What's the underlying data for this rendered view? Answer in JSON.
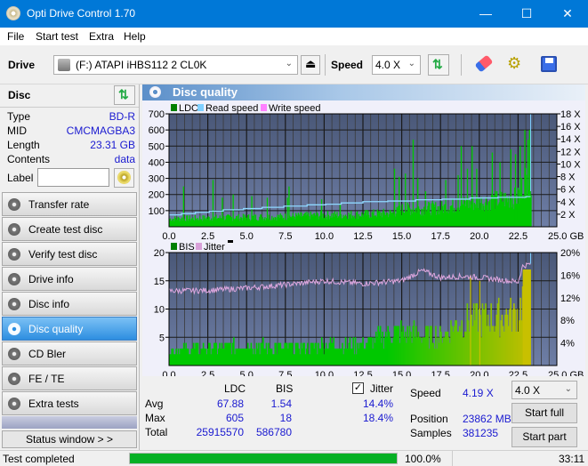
{
  "window": {
    "title": "Opti Drive Control 1.70",
    "minimize": "—",
    "maximize": "☐",
    "close": "✕"
  },
  "menu": [
    "File",
    "Start test",
    "Extra",
    "Help"
  ],
  "toolbar": {
    "drive_label": "Drive",
    "drive_value": "(F:)  ATAPI iHBS112  2 CL0K",
    "speed_label": "Speed",
    "speed_value": "4.0 X"
  },
  "disc": {
    "header": "Disc",
    "rows": [
      {
        "label": "Type",
        "value": "BD-R"
      },
      {
        "label": "MID",
        "value": "CMCMAGBA3"
      },
      {
        "label": "Length",
        "value": "23.31 GB"
      },
      {
        "label": "Contents",
        "value": "data"
      }
    ],
    "label_field_label": "Label",
    "label_field_value": ""
  },
  "nav": [
    {
      "label": "Transfer rate",
      "active": false
    },
    {
      "label": "Create test disc",
      "active": false
    },
    {
      "label": "Verify test disc",
      "active": false
    },
    {
      "label": "Drive info",
      "active": false
    },
    {
      "label": "Disc info",
      "active": false
    },
    {
      "label": "Disc quality",
      "active": true
    },
    {
      "label": "CD Bler",
      "active": false
    },
    {
      "label": "FE / TE",
      "active": false
    },
    {
      "label": "Extra tests",
      "active": false
    }
  ],
  "status_window_button": "Status window > >",
  "panel_title": "Disc quality",
  "colors": {
    "ldc": "#00c000",
    "read_speed": "#7fd0ff",
    "write_speed": "#ff80ff",
    "bis": "#00c000",
    "bis_high": "#c8c800",
    "jitter": "#d8a0d8",
    "plot_bg_top": "#4a5a7c",
    "plot_bg_bottom": "#6a7aa0",
    "progress": "#06b025"
  },
  "chart_data": [
    {
      "type": "bar",
      "title": "LDC / Read speed",
      "legend": [
        "LDC",
        "Read speed",
        "Write speed"
      ],
      "legend_position": "top-left",
      "xlabel": "GB",
      "x_ticks": [
        "0.0",
        "2.5",
        "5.0",
        "7.5",
        "10.0",
        "12.5",
        "15.0",
        "17.5",
        "20.0",
        "22.5",
        "25.0 GB"
      ],
      "xlim": [
        0,
        25
      ],
      "ylim": [
        0,
        700
      ],
      "y_ticks": [
        "100",
        "200",
        "300",
        "400",
        "500",
        "600",
        "700"
      ],
      "y2lim": [
        0,
        18
      ],
      "y2_ticks": [
        "2 X",
        "4 X",
        "6 X",
        "8 X",
        "10 X",
        "12 X",
        "14 X",
        "16 X",
        "18 X"
      ],
      "grid": true,
      "ldc_baseline": [
        [
          0,
          55
        ],
        [
          2.5,
          60
        ],
        [
          5,
          65
        ],
        [
          7.5,
          70
        ],
        [
          10,
          80
        ],
        [
          12.5,
          85
        ],
        [
          14.5,
          95
        ],
        [
          15,
          120
        ],
        [
          17.5,
          130
        ],
        [
          18.5,
          150
        ],
        [
          20,
          170
        ],
        [
          22.5,
          200
        ],
        [
          22.8,
          300
        ],
        [
          23.31,
          350
        ]
      ],
      "ldc_spikes": [
        [
          0.9,
          250
        ],
        [
          2.8,
          290
        ],
        [
          3.4,
          180
        ],
        [
          4.1,
          200
        ],
        [
          5.3,
          190
        ],
        [
          6.3,
          180
        ],
        [
          7.7,
          250
        ],
        [
          7.6,
          180
        ],
        [
          9.8,
          170
        ],
        [
          11.0,
          140
        ],
        [
          14.5,
          360
        ],
        [
          14.8,
          310
        ],
        [
          15.2,
          330
        ],
        [
          15.7,
          540
        ],
        [
          16.0,
          300
        ],
        [
          16.5,
          220
        ],
        [
          17.8,
          290
        ],
        [
          18.6,
          320
        ],
        [
          18.8,
          500
        ],
        [
          19.2,
          360
        ],
        [
          19.5,
          500
        ],
        [
          19.8,
          360
        ],
        [
          20.8,
          460
        ],
        [
          21.3,
          400
        ],
        [
          22.0,
          480
        ],
        [
          22.3,
          450
        ],
        [
          22.6,
          500
        ],
        [
          22.9,
          600
        ],
        [
          23.1,
          540
        ],
        [
          23.2,
          600
        ]
      ],
      "read_speed": [
        [
          0,
          1.9
        ],
        [
          0.8,
          2.1
        ],
        [
          1.7,
          2.3
        ],
        [
          2.6,
          2.5
        ],
        [
          3.5,
          2.7
        ],
        [
          4.8,
          2.9
        ],
        [
          6.0,
          3.1
        ],
        [
          7.4,
          3.3
        ],
        [
          8.9,
          3.5
        ],
        [
          10.1,
          3.6
        ],
        [
          11.1,
          3.8
        ],
        [
          12.5,
          4.0
        ],
        [
          14.1,
          4.1
        ],
        [
          15.9,
          4.3
        ],
        [
          17.6,
          4.4
        ],
        [
          19.4,
          4.6
        ],
        [
          21.2,
          4.7
        ],
        [
          23.0,
          4.8
        ],
        [
          23.31,
          4.8
        ]
      ]
    },
    {
      "type": "bar",
      "title": "BIS / Jitter",
      "legend": [
        "BIS",
        "Jitter"
      ],
      "legend_position": "top-left",
      "xlabel": "GB",
      "x_ticks": [
        "0.0",
        "2.5",
        "5.0",
        "7.5",
        "10.0",
        "12.5",
        "15.0",
        "17.5",
        "20.0",
        "22.5",
        "25.0 GB"
      ],
      "xlim": [
        0,
        25
      ],
      "ylim": [
        0,
        20
      ],
      "y_ticks": [
        "5",
        "10",
        "15",
        "20"
      ],
      "y2lim": [
        0,
        20
      ],
      "y2_ticks": [
        "4%",
        "8%",
        "12%",
        "16%",
        "20%"
      ],
      "grid": true,
      "bis_profile": [
        [
          0,
          4
        ],
        [
          2.5,
          4
        ],
        [
          5,
          5
        ],
        [
          7.5,
          4
        ],
        [
          10,
          5
        ],
        [
          12.5,
          5
        ],
        [
          14.5,
          8
        ],
        [
          17.5,
          7
        ],
        [
          18.5,
          10
        ],
        [
          20,
          11
        ],
        [
          22.5,
          12
        ],
        [
          22.8,
          17
        ],
        [
          23.31,
          17
        ]
      ],
      "jitter_profile": [
        [
          0,
          13.2
        ],
        [
          2.5,
          13.3
        ],
        [
          5,
          13.7
        ],
        [
          7.5,
          14.3
        ],
        [
          10,
          15.0
        ],
        [
          12.5,
          14.5
        ],
        [
          15,
          15.0
        ],
        [
          16.3,
          16.8
        ],
        [
          17.5,
          15.6
        ],
        [
          19,
          15.8
        ],
        [
          20,
          15.6
        ],
        [
          22.5,
          14.8
        ],
        [
          22.8,
          17.6
        ],
        [
          23.31,
          18.0
        ]
      ]
    }
  ],
  "stats": {
    "headers": {
      "ldc": "LDC",
      "bis": "BIS"
    },
    "jitter_checkbox_label": "Jitter",
    "jitter_checked": true,
    "rows": [
      {
        "label": "Avg",
        "ldc": "67.88",
        "bis": "1.54",
        "jitter": "14.4%"
      },
      {
        "label": "Max",
        "ldc": "605",
        "bis": "18",
        "jitter": "18.4%"
      },
      {
        "label": "Total",
        "ldc": "25915570",
        "bis": "586780",
        "jitter": ""
      }
    ],
    "speed_label": "Speed",
    "speed_value": "4.19 X",
    "position_label": "Position",
    "position_value": "23862 MB",
    "samples_label": "Samples",
    "samples_value": "381235",
    "speed_select": "4.0 X",
    "start_full": "Start full",
    "start_part": "Start part"
  },
  "statusbar": {
    "text": "Test completed",
    "progress_percent": 100.0,
    "progress_label": "100.0%",
    "time": "33:11"
  }
}
